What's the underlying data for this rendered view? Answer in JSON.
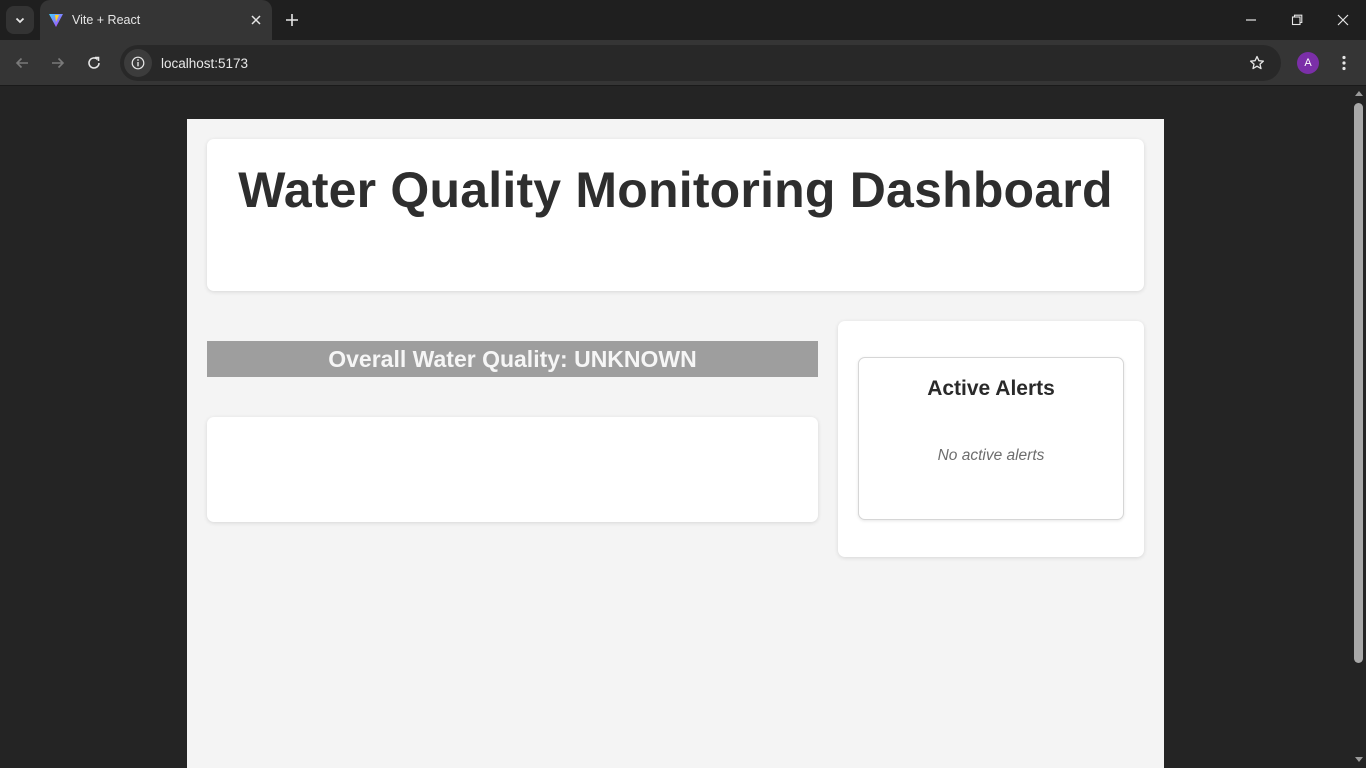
{
  "browser": {
    "tab_title": "Vite + React",
    "url": "localhost:5173",
    "profile_initial": "A"
  },
  "colors": {
    "banner_unknown": "#9e9e9e",
    "avatar": "#7b2fa8"
  },
  "icons": [
    "tab-search-icon",
    "vite-favicon-icon",
    "close-icon",
    "plus-icon",
    "minimize-icon",
    "restore-icon",
    "back-icon",
    "forward-icon",
    "reload-icon",
    "site-info-icon",
    "star-icon",
    "kebab-menu-icon"
  ],
  "dashboard": {
    "title": "Water Quality Monitoring Dashboard",
    "overall_quality": "Overall Water Quality: UNKNOWN",
    "alerts": {
      "title": "Active Alerts",
      "empty_message": "No active alerts"
    }
  }
}
